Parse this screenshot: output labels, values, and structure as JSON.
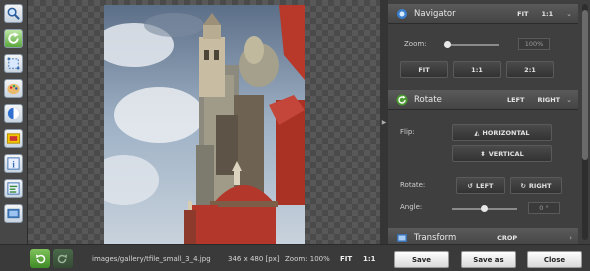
{
  "toolbar": {
    "tools": [
      {
        "name": "zoom-tool-icon"
      },
      {
        "name": "rotate-tool-icon"
      },
      {
        "name": "crop-tool-icon"
      },
      {
        "name": "palette-tool-icon"
      },
      {
        "name": "adjust-tool-icon"
      },
      {
        "name": "frame-tool-icon"
      },
      {
        "name": "text-tool-icon"
      },
      {
        "name": "effects-tool-icon"
      },
      {
        "name": "resize-tool-icon"
      }
    ]
  },
  "navigator": {
    "title": "Navigator",
    "action_fit": "FIT",
    "action_ratio": "1:1",
    "zoom_label": "Zoom:",
    "zoom_value": "100%",
    "zoom_fraction": 0.06,
    "buttons": {
      "fit": "FIT",
      "one": "1:1",
      "two": "2:1"
    }
  },
  "rotate": {
    "title": "Rotate",
    "action_left": "LEFT",
    "action_right": "RIGHT",
    "flip_label": "Flip:",
    "horizontal": "HORIZONTAL",
    "vertical": "VERTICAL",
    "rotate_label": "Rotate:",
    "left": "LEFT",
    "right": "RIGHT",
    "angle_label": "Angle:",
    "angle_value": "0 °",
    "angle_fraction": 0.5
  },
  "transform": {
    "title": "Transform",
    "action_crop": "CROP"
  },
  "statusbar": {
    "file_path": "images/gallery/tfile_small_3_4.jpg",
    "dimensions": "346 x 480 [px]",
    "zoom_text": "Zoom: 100%",
    "fit": "FIT",
    "ratio": "1:1",
    "save": "Save",
    "save_as": "Save as",
    "close": "Close"
  },
  "colors": {
    "accent_green": "#5aa83a",
    "panel": "#3f3f3f",
    "header": "#505050"
  }
}
